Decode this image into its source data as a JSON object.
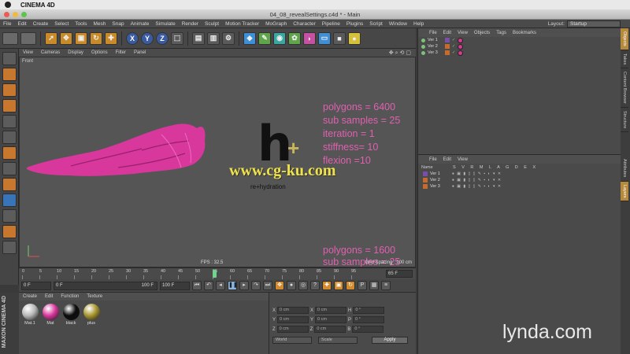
{
  "mac": {
    "app_name": "CINEMA 4D"
  },
  "window": {
    "title": "04_08_revealSettings.c4d * - Main"
  },
  "menu": [
    "File",
    "Edit",
    "Create",
    "Select",
    "Tools",
    "Mesh",
    "Snap",
    "Animate",
    "Simulate",
    "Render",
    "Sculpt",
    "Motion Tracker",
    "MoGraph",
    "Character",
    "Pipeline",
    "Plugins",
    "Script",
    "Window",
    "Help"
  ],
  "layout": {
    "label": "Layout:",
    "value": "Startup"
  },
  "toolbar": {
    "axes": [
      "X",
      "Y",
      "Z"
    ]
  },
  "viewport": {
    "menu": [
      "View",
      "Cameras",
      "Display",
      "Options",
      "Filter",
      "Panel"
    ],
    "label": "Front",
    "annotation_top": [
      "polygons = 6400",
      "sub samples = 25",
      "iteration = 1",
      "stiffness= 10",
      "flexion =10"
    ],
    "annotation_bottom": [
      "polygons = 1600",
      "sub samples = 25"
    ],
    "logo_letter": "h",
    "logo_plus": "+",
    "logo_sub": "re+hydration",
    "watermark": "www.cg-ku.com",
    "fps": "FPS : 32.5",
    "grid_spacing": "Grid Spacing : 100 cm",
    "cloth_color": "#d8389c",
    "annotation_color": "#e060b0"
  },
  "timeline": {
    "ticks": [
      "0",
      "5",
      "10",
      "15",
      "20",
      "25",
      "30",
      "35",
      "40",
      "45",
      "50",
      "55",
      "60",
      "65",
      "70",
      "75",
      "80",
      "85",
      "90",
      "95"
    ],
    "current_frame": 55,
    "end_label": "65 F"
  },
  "transport": {
    "start": "0 F",
    "current": "0 F",
    "end_min": "100 F",
    "end": "100 F"
  },
  "material_manager": {
    "menu": [
      "Create",
      "Edit",
      "Function",
      "Texture"
    ],
    "materials": [
      {
        "name": "Mat.1",
        "color": "#b8b8b8"
      },
      {
        "name": "Mat",
        "color": "#d8389c"
      },
      {
        "name": "black",
        "color": "#0c0c0c"
      },
      {
        "name": "plus",
        "color": "#a89630"
      }
    ],
    "brand": "MAXON CINEMA 4D"
  },
  "coordinates": {
    "rows": [
      {
        "a": "X",
        "av": "0 cm",
        "b": "X",
        "bv": "0 cm",
        "c": "H",
        "cv": "0 °"
      },
      {
        "a": "Y",
        "av": "0 cm",
        "b": "Y",
        "bv": "0 cm",
        "c": "P",
        "cv": "0 °"
      },
      {
        "a": "Z",
        "av": "0 cm",
        "b": "Z",
        "bv": "0 cm",
        "c": "B",
        "cv": "0 °"
      }
    ],
    "mode1": "World",
    "mode2": "Scale",
    "apply": "Apply"
  },
  "object_manager": {
    "menu": [
      "File",
      "Edit",
      "View",
      "Objects",
      "Tags",
      "Bookmarks"
    ],
    "objects": [
      {
        "name": "Ver 1",
        "color": "#7a4fa8"
      },
      {
        "name": "Ver 2",
        "color": "#c86a2a"
      },
      {
        "name": "Ver 3",
        "color": "#c86a2a"
      }
    ]
  },
  "layer_manager": {
    "menu": [
      "File",
      "Edit",
      "View"
    ],
    "header_name": "Name",
    "header_cols": "S V R M L A G D E X",
    "layers": [
      {
        "name": "Ver 1",
        "color": "#7a4fa8"
      },
      {
        "name": "Ver 2",
        "color": "#c86a2a"
      },
      {
        "name": "Ver 3",
        "color": "#c86a2a"
      }
    ]
  },
  "side_tabs": [
    "Objects",
    "Takes",
    "Content Browser",
    "Structure",
    "Attributes",
    "Layers"
  ],
  "brand_watermark": "lynda.com"
}
